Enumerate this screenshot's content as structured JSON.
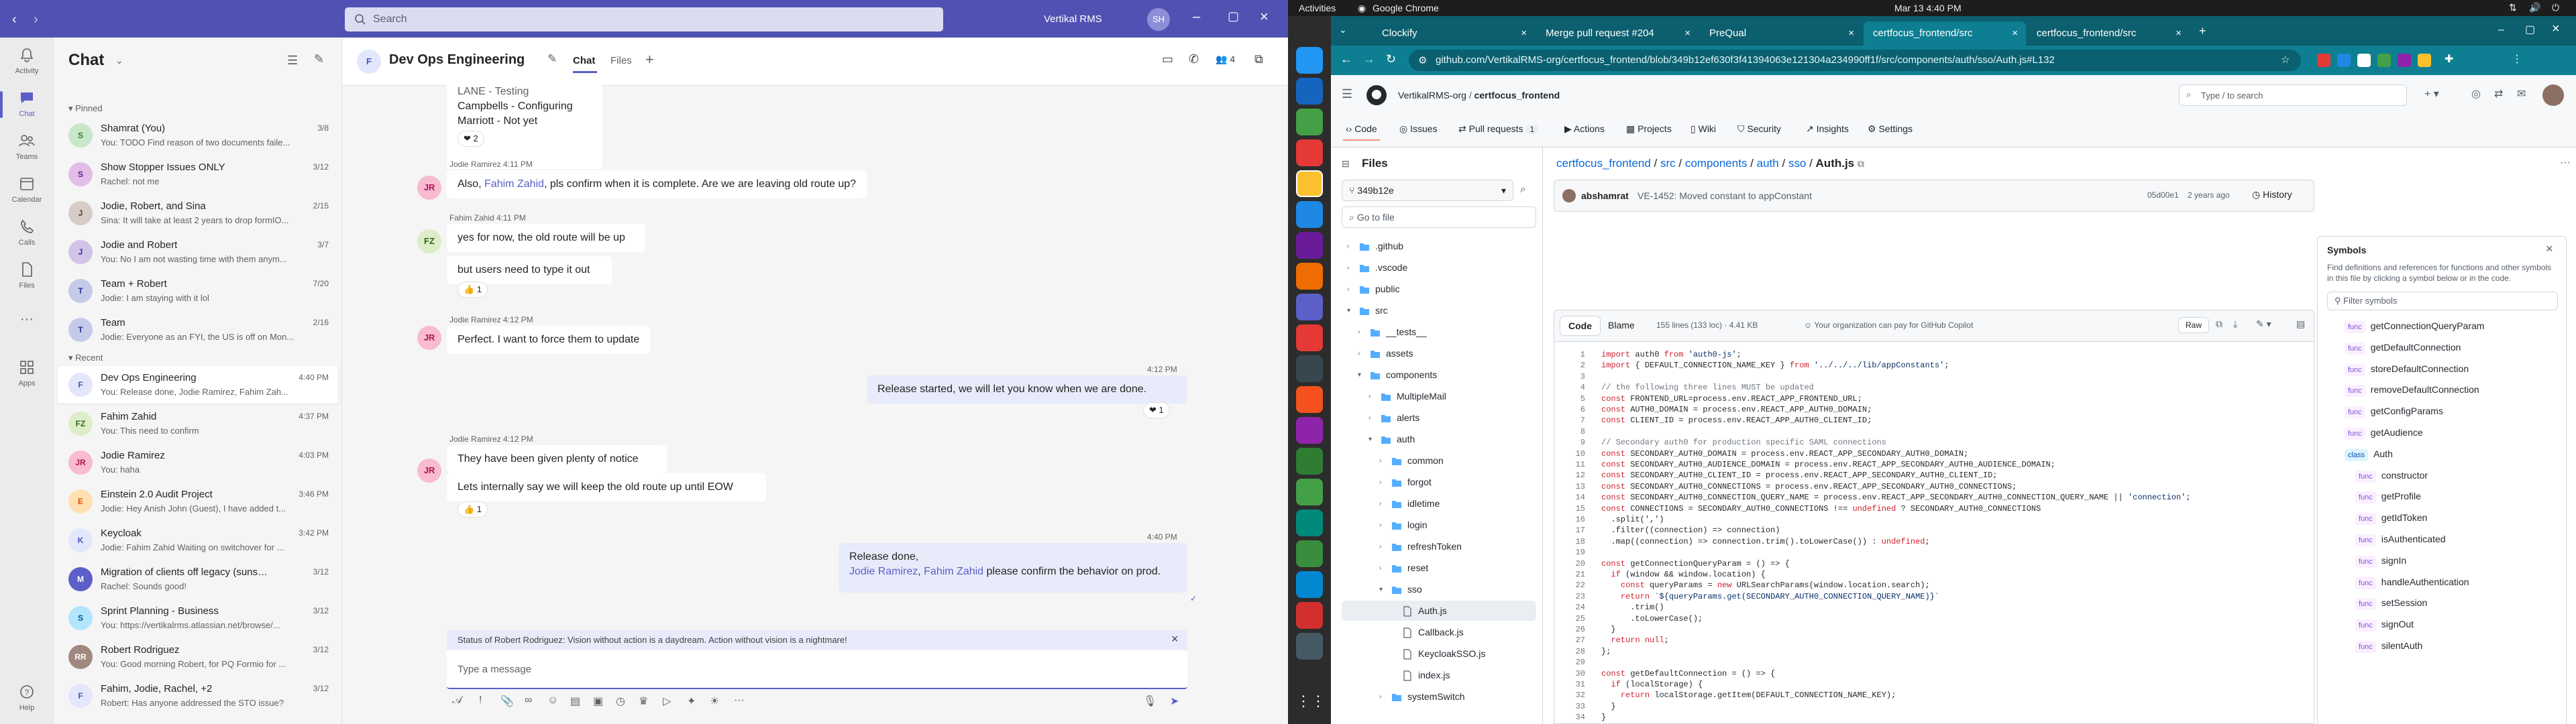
{
  "teams": {
    "search_placeholder": "Search",
    "org_name": "Vertikal RMS",
    "rail": [
      {
        "label": "Activity",
        "icon": "bell-icon"
      },
      {
        "label": "Chat",
        "icon": "chat-icon"
      },
      {
        "label": "Teams",
        "icon": "teams-icon"
      },
      {
        "label": "Calendar",
        "icon": "calendar-icon"
      },
      {
        "label": "Calls",
        "icon": "phone-icon"
      },
      {
        "label": "Files",
        "icon": "file-icon"
      },
      {
        "label": "Apps",
        "icon": "apps-icon"
      },
      {
        "label": "Help",
        "icon": "help-icon"
      }
    ],
    "list_title": "Chat",
    "pinned_label": "Pinned",
    "recent_label": "Recent",
    "pinned": [
      {
        "name": "Shamrat (You)",
        "preview": "You: TODO Find reason of two documents faile...",
        "time": "3/8",
        "initials": "S",
        "color": "#c8e6c9",
        "fg": "#2e7d32"
      },
      {
        "name": "Show Stopper Issues ONLY",
        "preview": "Rachel: not me",
        "time": "3/12",
        "initials": "S",
        "color": "#e1bee7",
        "fg": "#6a1b9a"
      },
      {
        "name": "Jodie, Robert, and Sina",
        "preview": "Sina: It will take at least 2 years to drop formIO...",
        "time": "2/15",
        "initials": "J",
        "color": "#d7ccc8",
        "fg": "#5d4037"
      },
      {
        "name": "Jodie and Robert",
        "preview": "You: No I am not wasting time with them anym...",
        "time": "3/7",
        "initials": "J",
        "color": "#d1c4e9",
        "fg": "#4527a0"
      },
      {
        "name": "Team + Robert",
        "preview": "Jodie: I am staying with it lol",
        "time": "7/20",
        "initials": "T",
        "color": "#c5cae9",
        "fg": "#283593"
      },
      {
        "name": "Team",
        "preview": "Jodie: Everyone as an FYI, the US is off on Mon...",
        "time": "2/16",
        "initials": "T",
        "color": "#c5cae9",
        "fg": "#283593"
      }
    ],
    "recent": [
      {
        "name": "Dev Ops Engineering",
        "preview": "You: Release done, Jodie Ramirez, Fahim Zah...",
        "time": "4:40 PM",
        "initials": "F",
        "color": "#e3e7fb",
        "fg": "#4f52b2",
        "selected": true
      },
      {
        "name": "Fahim Zahid",
        "preview": "You: This need to confirm",
        "time": "4:37 PM",
        "initials": "FZ",
        "color": "#dcedc8",
        "fg": "#33691e"
      },
      {
        "name": "Jodie Ramirez",
        "preview": "You: haha",
        "time": "4:03 PM",
        "initials": "JR",
        "color": "#f8bbd0",
        "fg": "#ad1457"
      },
      {
        "name": "Einstein 2.0 Audit Project",
        "preview": "Jodie: Hey Anish John (Guest), I have added t...",
        "time": "3:46 PM",
        "initials": "E",
        "color": "#ffe0b2",
        "fg": "#e65100"
      },
      {
        "name": "Keycloak",
        "preview": "Jodie: Fahim Zahid Waiting on switchover for ...",
        "time": "3:42 PM",
        "initials": "K",
        "color": "#e3e7fb",
        "fg": "#4f52b2"
      },
      {
        "name": "Migration of clients off legacy (sunse...",
        "preview": "Rachel: Sounds good!",
        "time": "3/12",
        "initials": "M",
        "color": "#5b5fc7",
        "fg": "#ffffff"
      },
      {
        "name": "Sprint Planning - Business",
        "preview": "You: https://vertikalrms.atlassian.net/browse/...",
        "time": "3/12",
        "initials": "S",
        "color": "#b3e5fc",
        "fg": "#01579b"
      },
      {
        "name": "Robert Rodriguez",
        "preview": "You: Good morning Robert, for PQ Formio for ...",
        "time": "3/12",
        "initials": "RR",
        "color": "#a1887f",
        "fg": "#ffffff"
      },
      {
        "name": "Fahim, Jodie, Rachel, +2",
        "preview": "Robert: Has anyone addressed the STO issue?",
        "time": "3/12",
        "initials": "F",
        "color": "#e3e7fb",
        "fg": "#4f52b2"
      }
    ],
    "chat": {
      "title": "Dev Ops Engineering",
      "tab_chat": "Chat",
      "tab_files": "Files",
      "participants": "4",
      "top_lines": [
        "LANE - Testing",
        "Campbells - Configuring",
        "Marriott - Not yet"
      ],
      "top_react": "2",
      "messages": [
        {
          "author": "Jodie Ramirez  4:11 PM",
          "pre": "Also, ",
          "mention": "Fahim Zahid",
          "post": ", pls confirm when it is complete.  Are we are leaving old route up?"
        },
        {
          "author": "Fahim Zahid  4:11 PM",
          "l1": "yes for now, the old route will be up",
          "l2": "but users need to type it out",
          "react": "1"
        },
        {
          "author": "Jodie Ramirez  4:12 PM",
          "text": "Perfect.  I want to force them to update"
        },
        {
          "time": "4:12 PM",
          "text": "Release started, we will let you know when we are done.",
          "react": "1"
        },
        {
          "author": "Jodie Ramirez  4:12 PM",
          "l1": "They have been given plenty of notice",
          "l2": "Lets internally say we will keep the old route up until EOW",
          "react": "1"
        },
        {
          "time": "4:40 PM",
          "l1": "Release done,",
          "m1": "Jodie Ramirez",
          "sep": ", ",
          "m2": "Fahim Zahid",
          "l2": " please confirm the behavior on prod."
        }
      ],
      "status_banner": "Status of Robert Rodriguez: Vision without action is a daydream. Action without vision is a nightmare!",
      "compose_placeholder": "Type a message"
    }
  },
  "chrome": {
    "topbar": {
      "activities": "Activities",
      "app": "Google Chrome",
      "clock": "Mar 13  4:40 PM"
    },
    "tabs": [
      "Clockify",
      "Merge pull request #204",
      "PreQual",
      "certfocus_frontend/src",
      "certfocus_frontend/src"
    ],
    "url": "github.com/VertikalRMS-org/certfocus_frontend/blob/349b12ef630f3f41394063e121304a234990ff1f/src/components/auth/sso/Auth.js#L132",
    "github": {
      "org": "VertikalRMS-org",
      "sep": "/",
      "repo": "certfocus_frontend",
      "search_placeholder": "Type / to search",
      "nav": [
        {
          "label": "Code",
          "active": true
        },
        {
          "label": "Issues"
        },
        {
          "label": "Pull requests",
          "count": "1"
        },
        {
          "label": "Actions"
        },
        {
          "label": "Projects"
        },
        {
          "label": "Wiki"
        },
        {
          "label": "Security"
        },
        {
          "label": "Insights"
        },
        {
          "label": "Settings"
        }
      ],
      "files_title": "Files",
      "branch": "349b12e",
      "goto_placeholder": "Go to file",
      "tree": [
        {
          "name": ".github",
          "type": "dir",
          "depth": 0
        },
        {
          "name": ".vscode",
          "type": "dir",
          "depth": 0
        },
        {
          "name": "public",
          "type": "dir",
          "depth": 0
        },
        {
          "name": "src",
          "type": "dir",
          "depth": 0,
          "open": true
        },
        {
          "name": "__tests__",
          "type": "dir",
          "depth": 1
        },
        {
          "name": "assets",
          "type": "dir",
          "depth": 1
        },
        {
          "name": "components",
          "type": "dir",
          "depth": 1,
          "open": true
        },
        {
          "name": "MultipleMail",
          "type": "dir",
          "depth": 2
        },
        {
          "name": "alerts",
          "type": "dir",
          "depth": 2
        },
        {
          "name": "auth",
          "type": "dir",
          "depth": 2,
          "open": true
        },
        {
          "name": "common",
          "type": "dir",
          "depth": 3
        },
        {
          "name": "forgot",
          "type": "dir",
          "depth": 3
        },
        {
          "name": "idletime",
          "type": "dir",
          "depth": 3
        },
        {
          "name": "login",
          "type": "dir",
          "depth": 3
        },
        {
          "name": "refreshToken",
          "type": "dir",
          "depth": 3
        },
        {
          "name": "reset",
          "type": "dir",
          "depth": 3
        },
        {
          "name": "sso",
          "type": "dir",
          "depth": 3,
          "open": true
        },
        {
          "name": "Auth.js",
          "type": "file",
          "depth": 4,
          "selected": true
        },
        {
          "name": "Callback.js",
          "type": "file",
          "depth": 4
        },
        {
          "name": "KeycloakSSO.js",
          "type": "file",
          "depth": 4
        },
        {
          "name": "index.js",
          "type": "file",
          "depth": 4
        },
        {
          "name": "systemSwitch",
          "type": "dir",
          "depth": 3
        }
      ],
      "breadcrumb": [
        "certfocus_frontend",
        "src",
        "components",
        "auth",
        "sso",
        "Auth.js"
      ],
      "commit": {
        "author": "abshamrat",
        "message": "VE-1452: Moved constant to appConstant",
        "sha": "05d00e1",
        "age": "2 years ago",
        "history": "History"
      },
      "code_tab": "Code",
      "blame_tab": "Blame",
      "file_info": "155 lines (133 loc) · 4.41 KB",
      "copilot": "Your organization can pay for GitHub Copilot",
      "raw": "Raw",
      "lines": [
        "import auth0 from 'auth0-js';",
        "import { DEFAULT_CONNECTION_NAME_KEY } from '../../../lib/appConstants';",
        "",
        "// the following three lines MUST be updated",
        "const FRONTEND_URL=process.env.REACT_APP_FRONTEND_URL;",
        "const AUTH0_DOMAIN = process.env.REACT_APP_AUTH0_DOMAIN;",
        "const CLIENT_ID = process.env.REACT_APP_AUTH0_CLIENT_ID;",
        "",
        "// Secondary auth0 for production specific SAML connections",
        "const SECONDARY_AUTH0_DOMAIN = process.env.REACT_APP_SECONDARY_AUTH0_DOMAIN;",
        "const SECONDARY_AUTH0_AUDIENCE_DOMAIN = process.env.REACT_APP_SECONDARY_AUTH0_AUDIENCE_DOMAIN;",
        "const SECONDARY_AUTH0_CLIENT_ID = process.env.REACT_APP_SECONDARY_AUTH0_CLIENT_ID;",
        "const SECONDARY_AUTH0_CONNECTIONS = process.env.REACT_APP_SECONDARY_AUTH0_CONNECTIONS;",
        "const SECONDARY_AUTH0_CONNECTION_QUERY_NAME = process.env.REACT_APP_SECONDARY_AUTH0_CONNECTION_QUERY_NAME || 'connection';",
        "const CONNECTIONS = SECONDARY_AUTH0_CONNECTIONS !== undefined ? SECONDARY_AUTH0_CONNECTIONS",
        "  .split(',')",
        "  .filter((connection) => connection)",
        "  .map((connection) => connection.trim().toLowerCase()) : undefined;",
        "",
        "const getConnectionQueryParam = () => {",
        "  if (window && window.location) {",
        "    const queryParams = new URLSearchParams(window.location.search);",
        "    return `${queryParams.get(SECONDARY_AUTH0_CONNECTION_QUERY_NAME)}`",
        "      .trim()",
        "      .toLowerCase();",
        "  }",
        "  return null;",
        "};",
        "",
        "const getDefaultConnection = () => {",
        "  if (localStorage) {",
        "    return localStorage.getItem(DEFAULT_CONNECTION_NAME_KEY);",
        "  }",
        "}"
      ],
      "symbols": {
        "title": "Symbols",
        "desc": "Find definitions and references for functions and other symbols in this file by clicking a symbol below or in the code.",
        "filter_placeholder": "Filter symbols",
        "items": [
          {
            "tag": "func",
            "name": "getConnectionQueryParam",
            "indent": 0
          },
          {
            "tag": "func",
            "name": "getDefaultConnection",
            "indent": 0
          },
          {
            "tag": "func",
            "name": "storeDefaultConnection",
            "indent": 0
          },
          {
            "tag": "func",
            "name": "removeDefaultConnection",
            "indent": 0
          },
          {
            "tag": "func",
            "name": "getConfigParams",
            "indent": 0
          },
          {
            "tag": "func",
            "name": "getAudience",
            "indent": 0
          },
          {
            "tag": "class",
            "name": "Auth",
            "indent": 0
          },
          {
            "tag": "func",
            "name": "constructor",
            "indent": 1
          },
          {
            "tag": "func",
            "name": "getProfile",
            "indent": 1
          },
          {
            "tag": "func",
            "name": "getIdToken",
            "indent": 1
          },
          {
            "tag": "func",
            "name": "isAuthenticated",
            "indent": 1
          },
          {
            "tag": "func",
            "name": "signIn",
            "indent": 1
          },
          {
            "tag": "func",
            "name": "handleAuthentication",
            "indent": 1
          },
          {
            "tag": "func",
            "name": "setSession",
            "indent": 1
          },
          {
            "tag": "func",
            "name": "signOut",
            "indent": 1
          },
          {
            "tag": "func",
            "name": "silentAuth",
            "indent": 1
          }
        ]
      }
    }
  }
}
